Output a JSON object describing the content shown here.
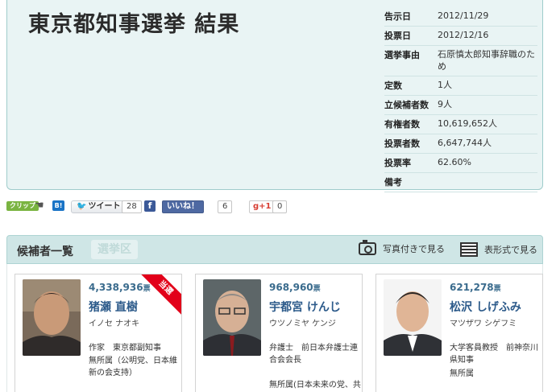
{
  "header": {
    "title": "東京都知事選挙 結果"
  },
  "info": [
    {
      "label": "告示日",
      "value": "2012/11/29"
    },
    {
      "label": "投票日",
      "value": "2012/12/16"
    },
    {
      "label": "選挙事由",
      "value": "石原慎太郎知事辞職のため"
    },
    {
      "label": "定数",
      "value": "1人"
    },
    {
      "label": "立候補者数",
      "value": "9人"
    },
    {
      "label": "有権者数",
      "value": "10,619,652人"
    },
    {
      "label": "投票者数",
      "value": "6,647,744人"
    },
    {
      "label": "投票率",
      "value": "62.60%"
    },
    {
      "label": "備考",
      "value": ""
    }
  ],
  "social": {
    "clip_label": "クリップ",
    "hatena_label": "B!",
    "tweet_label": "ツイート",
    "tweet_count": "28",
    "fb_label": "f",
    "like_label": "いいね！",
    "like_count": "6",
    "gplus_label": "g+1",
    "gplus_count": "0"
  },
  "tabs": {
    "title": "候補者一覧",
    "district": "選挙区",
    "photo_view": "写真付きで見る",
    "table_view": "表形式で見る"
  },
  "candidates": [
    {
      "votes": "4,338,936",
      "unit": "票",
      "name": "猪瀬 直樹",
      "kana": "イノセ ナオキ",
      "job": "作家　東京都副知事",
      "party": "無所属（公明党、日本維新の会支持）",
      "badge": "当選"
    },
    {
      "votes": "968,960",
      "unit": "票",
      "name": "宇都宮 けんじ",
      "kana": "ウツノミヤ ケンジ",
      "job": "弁護士　前日本弁護士連合会会長",
      "party": "無所属(日本未来の党、共産党、社民党支持)",
      "badge": ""
    },
    {
      "votes": "621,278",
      "unit": "票",
      "name": "松沢 しげふみ",
      "kana": "マツザワ シゲフミ",
      "job": "大学客員教授　前神奈川県知事",
      "party": "無所属",
      "badge": ""
    }
  ],
  "colors": {
    "accent": "#2c5a8a",
    "panel": "#e9f4f4",
    "win_badge": "#e2001a"
  }
}
